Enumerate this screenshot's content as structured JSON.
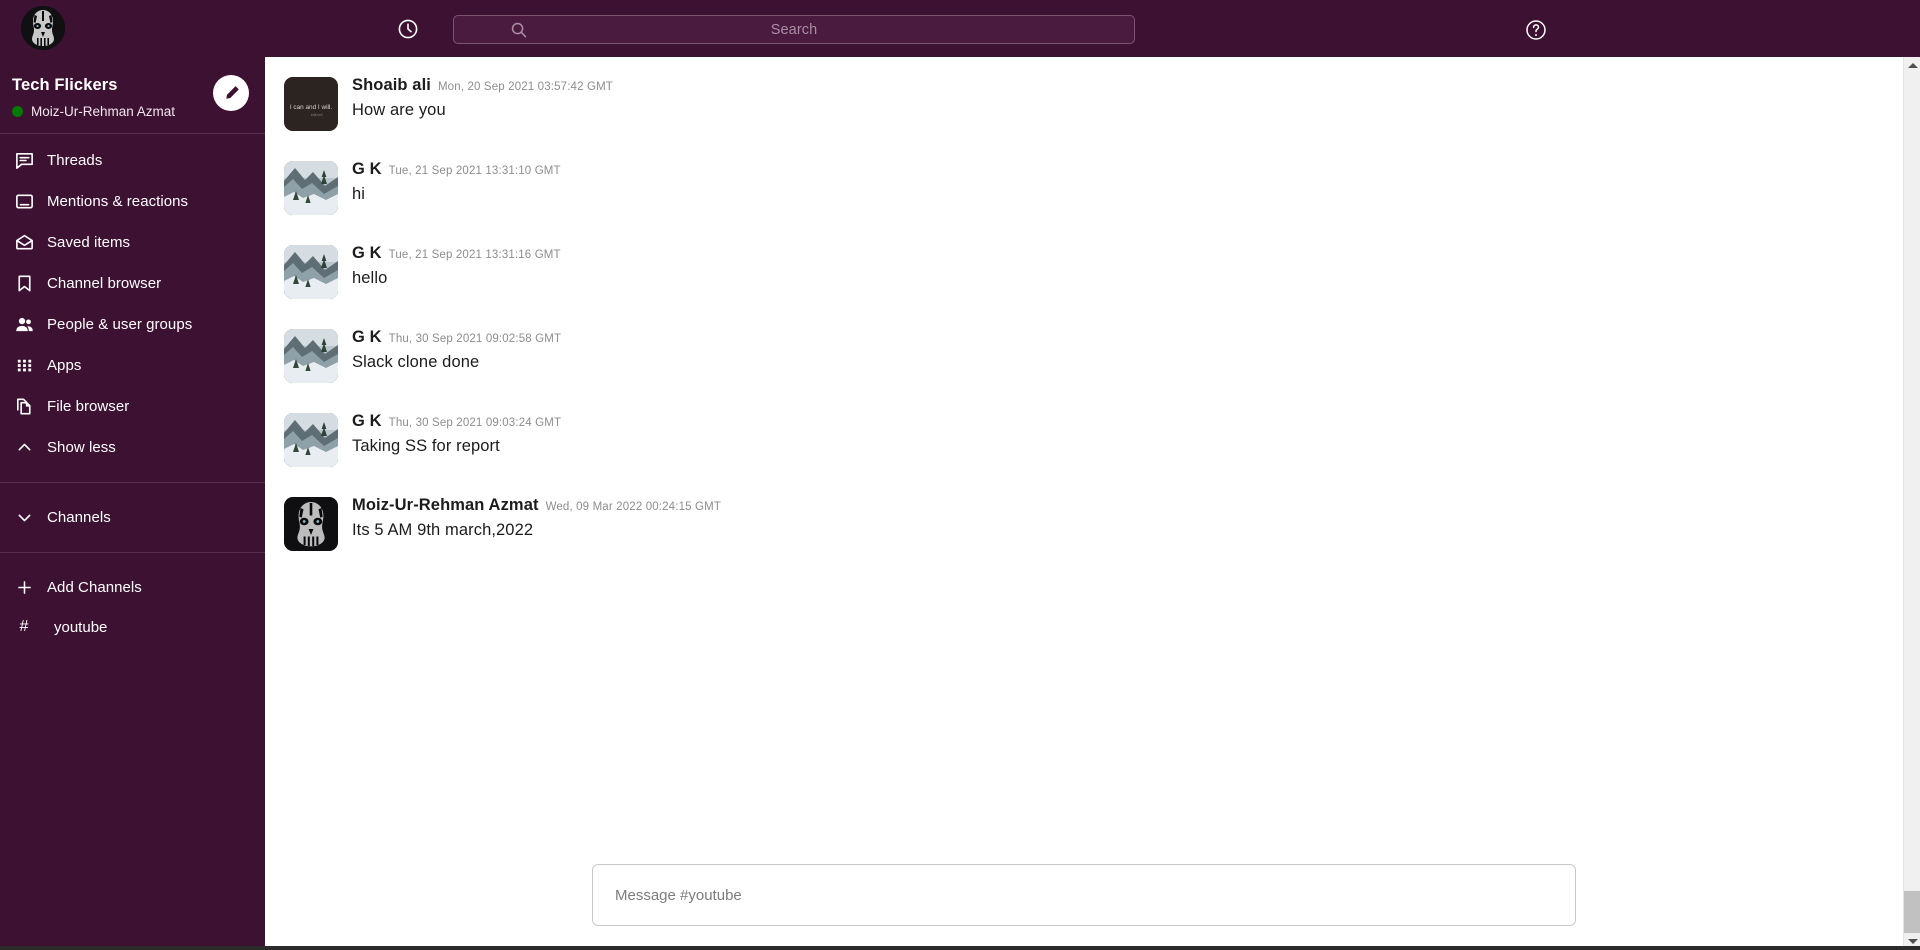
{
  "topbar": {
    "avatar_name": "user-avatar-skull",
    "history_icon": "clock-history-icon",
    "search_icon": "search-icon",
    "search_placeholder": "Search",
    "search_value": "",
    "help_icon": "help-circle-icon"
  },
  "sidebar": {
    "workspace_name": "Tech Flickers",
    "user_name": "Moiz-Ur-Rehman Azmat",
    "presence": "online",
    "compose_icon": "pencil-compose-icon",
    "nav_items": [
      {
        "label": "Threads",
        "icon": "threads-icon"
      },
      {
        "label": "Mentions & reactions",
        "icon": "mentions-icon"
      },
      {
        "label": "Saved items",
        "icon": "saved-items-icon"
      },
      {
        "label": "Channel browser",
        "icon": "bookmark-icon"
      },
      {
        "label": "People & user groups",
        "icon": "people-icon"
      },
      {
        "label": "Apps",
        "icon": "apps-grid-icon"
      },
      {
        "label": "File browser",
        "icon": "files-icon"
      },
      {
        "label": "Show less",
        "icon": "chevron-up-icon"
      }
    ],
    "channels_header": {
      "label": "Channels",
      "icon": "chevron-down-icon"
    },
    "add_channels": {
      "label": "Add Channels",
      "icon": "plus-icon"
    },
    "channels": [
      {
        "label": "youtube",
        "prefix": "#"
      }
    ]
  },
  "main": {
    "messages": [
      {
        "author": "Shoaib ali",
        "timestamp": "Mon, 20 Sep 2021 03:57:42 GMT",
        "text": "How are you",
        "avatar": "quote-card-avatar",
        "avatar_text": "I can and I will."
      },
      {
        "author": "G K",
        "timestamp": "Tue, 21 Sep 2021 13:31:10 GMT",
        "text": "hi",
        "avatar": "snowy-mountain-avatar"
      },
      {
        "author": "G K",
        "timestamp": "Tue, 21 Sep 2021 13:31:16 GMT",
        "text": "hello",
        "avatar": "snowy-mountain-avatar"
      },
      {
        "author": "G K",
        "timestamp": "Thu, 30 Sep 2021 09:02:58 GMT",
        "text": "Slack clone done",
        "avatar": "snowy-mountain-avatar"
      },
      {
        "author": "G K",
        "timestamp": "Thu, 30 Sep 2021 09:03:24 GMT",
        "text": "Taking SS for report",
        "avatar": "snowy-mountain-avatar"
      },
      {
        "author": "Moiz-Ur-Rehman Azmat",
        "timestamp": "Wed, 09 Mar 2022 00:24:15 GMT",
        "text": "Its 5 AM 9th march,2022",
        "avatar": "skull-avatar"
      }
    ],
    "composer_placeholder": "Message #youtube",
    "composer_value": ""
  },
  "colors": {
    "sidebar_bg": "#3d1132",
    "topbar_bg": "#3d1132",
    "presence_green": "#007a00",
    "text_primary": "#1d1c1d",
    "text_muted": "#8d8d8d"
  }
}
